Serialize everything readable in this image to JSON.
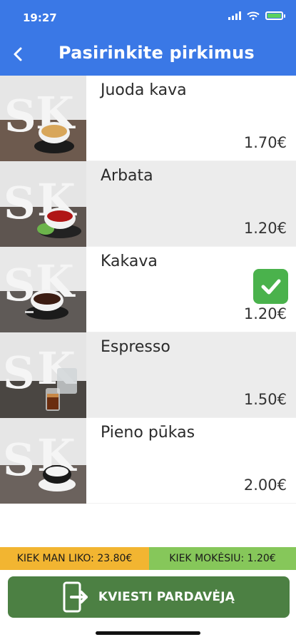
{
  "status_bar": {
    "time": "19:27"
  },
  "header": {
    "title": "Pasirinkite pirkimus",
    "back_icon": "back-chevron-icon"
  },
  "products": [
    {
      "name": "Juoda kava",
      "price": "1.70€",
      "selected": false,
      "cup_color": "#d8a65a",
      "saucer_color": "#1b1b1b"
    },
    {
      "name": "Arbata",
      "price": "1.20€",
      "selected": false,
      "cup_color": "#b01616",
      "saucer_color": "#222222"
    },
    {
      "name": "Kakava",
      "price": "1.20€",
      "selected": true,
      "cup_color": "#3b1c12",
      "saucer_color": "#1b1b1b"
    },
    {
      "name": "Espresso",
      "price": "1.50€",
      "selected": false,
      "cup_color": "#6a2d0f",
      "saucer_color": "#2a2a2a"
    },
    {
      "name": "Pieno pūkas",
      "price": "2.00€",
      "selected": false,
      "cup_color": "#f3f3f3",
      "saucer_color": "#f3f3f3"
    }
  ],
  "summary": {
    "balance_text": "KIEK MAN LIKO: 23.80€",
    "paying_text": "KIEK MOKĖSIU: 1.20€"
  },
  "call_button": {
    "label": "KVIESTI PARDAVĖJĄ",
    "icon": "exit-door-icon"
  },
  "colors": {
    "header": "#3a78e6",
    "balance_bg": "#f2b531",
    "paying_bg": "#86c75a",
    "call_bg": "#4c8043",
    "check_bg": "#4ab24c"
  }
}
